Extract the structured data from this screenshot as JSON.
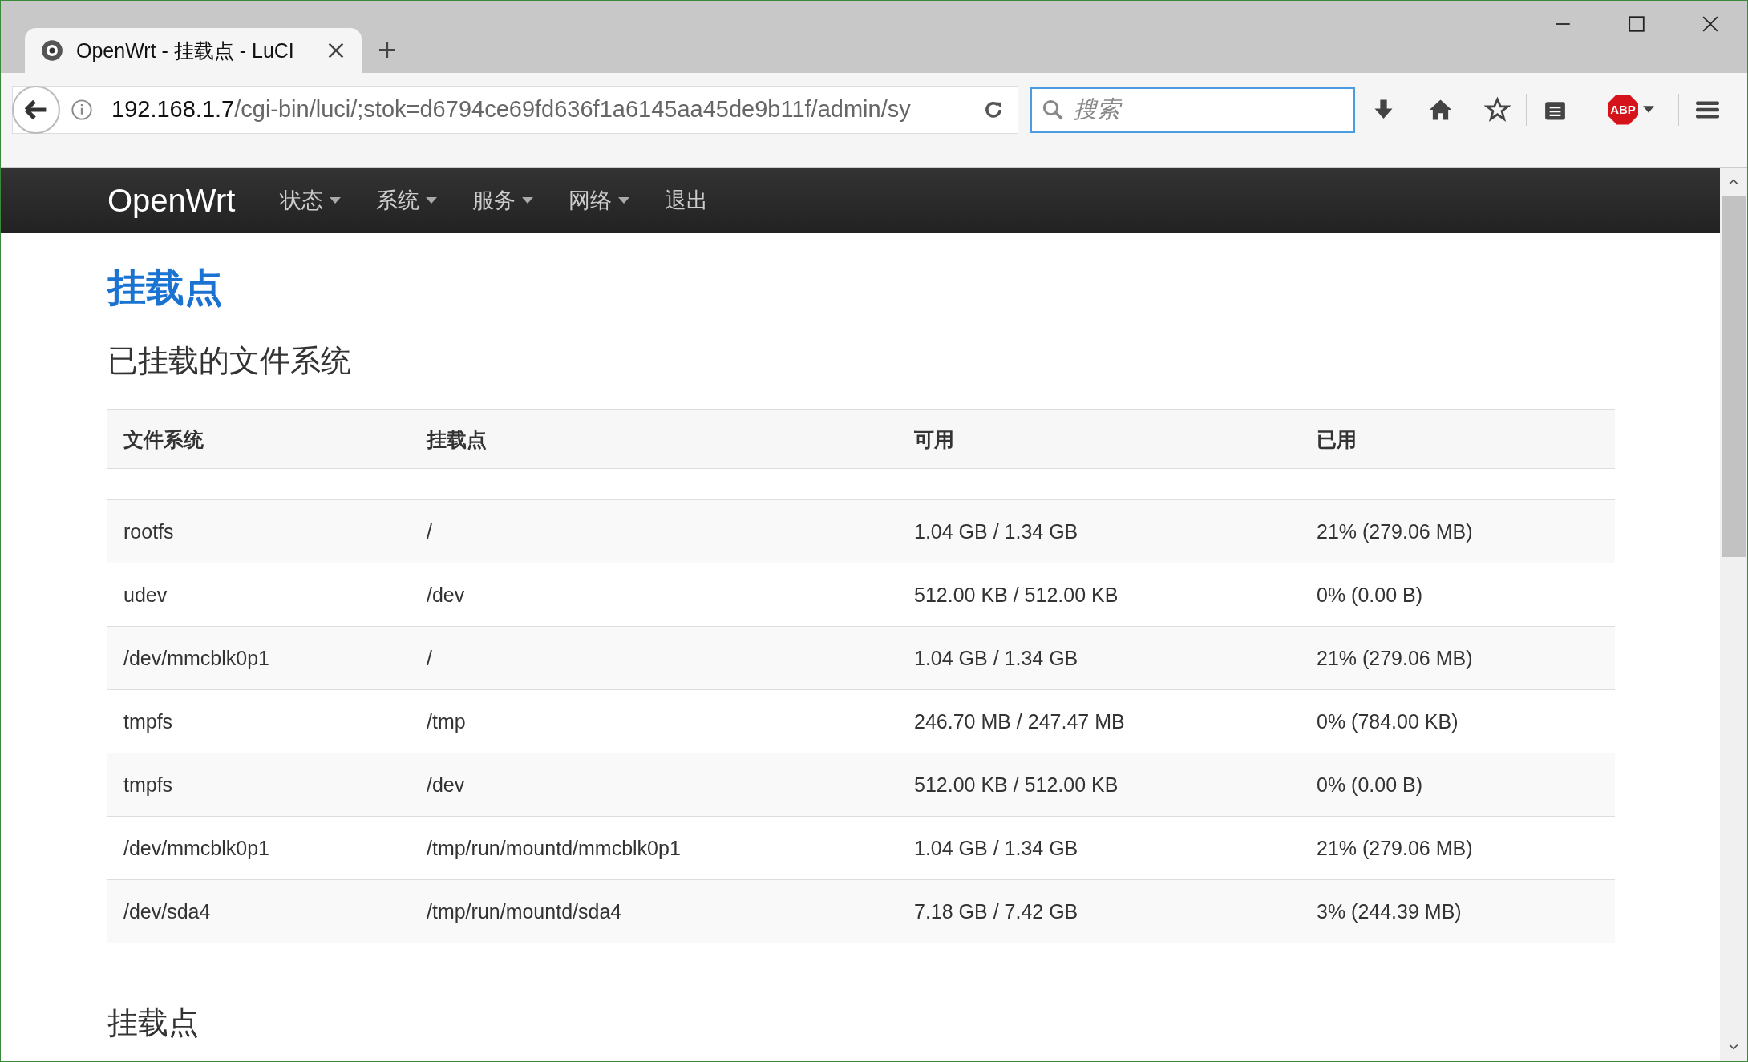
{
  "browser": {
    "tab": {
      "title": "OpenWrt - 挂载点 - LuCI",
      "selected": true
    },
    "new_tab": "+",
    "url": {
      "host": "192.168.1.7",
      "path": "/cgi-bin/luci/;stok=d6794ce69fd636f1a6145aa45de9b11f/admin/sy"
    },
    "search": {
      "placeholder": "搜索"
    },
    "adblock_label": "ABP"
  },
  "nav": {
    "brand": "OpenWrt",
    "items": [
      {
        "label": "状态",
        "dropdown": true
      },
      {
        "label": "系统",
        "dropdown": true
      },
      {
        "label": "服务",
        "dropdown": true
      },
      {
        "label": "网络",
        "dropdown": true
      },
      {
        "label": "退出",
        "dropdown": false
      }
    ]
  },
  "page": {
    "title": "挂载点",
    "section_title": "已挂载的文件系统",
    "table": {
      "columns": [
        "文件系统",
        "挂载点",
        "可用",
        "已用"
      ],
      "rows": [
        [
          "rootfs",
          "/",
          "1.04 GB / 1.34 GB",
          "21% (279.06 MB)"
        ],
        [
          "udev",
          "/dev",
          "512.00 KB / 512.00 KB",
          "0% (0.00 B)"
        ],
        [
          "/dev/mmcblk0p1",
          "/",
          "1.04 GB / 1.34 GB",
          "21% (279.06 MB)"
        ],
        [
          "tmpfs",
          "/tmp",
          "246.70 MB / 247.47 MB",
          "0% (784.00 KB)"
        ],
        [
          "tmpfs",
          "/dev",
          "512.00 KB / 512.00 KB",
          "0% (0.00 B)"
        ],
        [
          "/dev/mmcblk0p1",
          "/tmp/run/mountd/mmcblk0p1",
          "1.04 GB / 1.34 GB",
          "21% (279.06 MB)"
        ],
        [
          "/dev/sda4",
          "/tmp/run/mountd/sda4",
          "7.18 GB / 7.42 GB",
          "3% (244.39 MB)"
        ]
      ]
    },
    "next_section_title": "挂载点"
  }
}
